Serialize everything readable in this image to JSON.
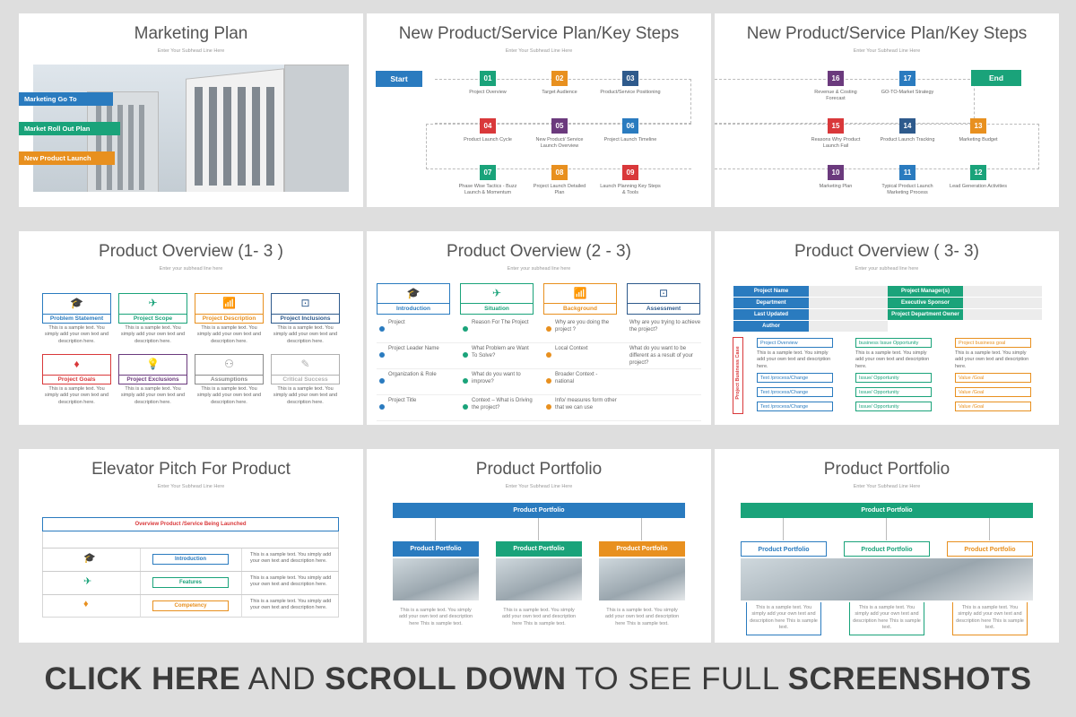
{
  "slides": {
    "marketing": {
      "title": "Marketing Plan",
      "subtitle": "Enter Your Subhead Line Here",
      "tags": [
        "Marketing Go To",
        "Market Roll Out Plan",
        "New Product Launch"
      ]
    },
    "steps1": {
      "title": "New Product/Service Plan/Key Steps",
      "subtitle": "Enter Your Subhead Line Here",
      "start": "Start",
      "steps": [
        {
          "num": "01",
          "label": "Project Overview",
          "color": "#1aa37a"
        },
        {
          "num": "02",
          "label": "Target Audience",
          "color": "#e8901f"
        },
        {
          "num": "03",
          "label": "Product/Service Positioning",
          "color": "#2e5a8c"
        },
        {
          "num": "04",
          "label": "Product Launch Cycle",
          "color": "#d9383a"
        },
        {
          "num": "05",
          "label": "New Product/ Service Launch Overview",
          "color": "#6b3a7d"
        },
        {
          "num": "06",
          "label": "Project Launch Timeline",
          "color": "#2a7bbf"
        },
        {
          "num": "07",
          "label": "Phase Wise Tactics - Buzz Launch & Momentum",
          "color": "#1aa37a"
        },
        {
          "num": "08",
          "label": "Project Launch Detailed Plan",
          "color": "#e8901f"
        },
        {
          "num": "09",
          "label": "Launch Planning Key Steps & Tools",
          "color": "#d9383a"
        }
      ]
    },
    "steps2": {
      "title": "New Product/Service Plan/Key Steps",
      "subtitle": "Enter Your Subhead Line Here",
      "end": "End",
      "steps": [
        {
          "num": "16",
          "label": "Revenue & Costing Forecast",
          "color": "#6b3a7d"
        },
        {
          "num": "17",
          "label": "GO-TO-Market Strategy",
          "color": "#2a7bbf"
        },
        {
          "num": "15",
          "label": "Reasons Why Product Launch Fail",
          "color": "#d9383a"
        },
        {
          "num": "14",
          "label": "Product Launch Tracking",
          "color": "#2e5a8c"
        },
        {
          "num": "13",
          "label": "Marketing Budget",
          "color": "#e8901f"
        },
        {
          "num": "10",
          "label": "Marketing Plan",
          "color": "#6b3a7d"
        },
        {
          "num": "11",
          "label": "Typical Product Launch Marketing Process",
          "color": "#2a7bbf"
        },
        {
          "num": "12",
          "label": "Lead Generation Activities",
          "color": "#1aa37a"
        }
      ]
    },
    "ov1": {
      "title": "Product Overview (1- 3 )",
      "subtitle": "Enter your subhead line here",
      "sample": "This is a sample text. You simply add your own text and description here.",
      "cards": [
        {
          "label": "Problem Statement",
          "color": "#2a7bbf"
        },
        {
          "label": "Project Scope",
          "color": "#1aa37a"
        },
        {
          "label": "Project Description",
          "color": "#e8901f"
        },
        {
          "label": "Project Inclusions",
          "color": "#2e5a8c"
        },
        {
          "label": "Project Goals",
          "color": "#d9383a"
        },
        {
          "label": "Project Exclusions",
          "color": "#6b3a7d"
        },
        {
          "label": "Assumptions",
          "color": "#8a8a8a"
        },
        {
          "label": "Critical Success",
          "color": "#b0b0b0"
        }
      ]
    },
    "ov2": {
      "title": "Product Overview (2 - 3)",
      "subtitle": "Enter your subhead line here",
      "heads": [
        {
          "label": "Introduction",
          "color": "#2a7bbf"
        },
        {
          "label": "Situation",
          "color": "#1aa37a"
        },
        {
          "label": "Background",
          "color": "#e8901f"
        },
        {
          "label": "Assessment",
          "color": "#2e5a8c"
        }
      ],
      "rows": [
        [
          "Project",
          "Reason For The Project",
          "Why are you doing the project ?",
          "Why are you trying to achieve the project?"
        ],
        [
          "Project Leader Name",
          "What Problem are Want To Solve?",
          "Local Context",
          "What do you want to be different as a result of your project?"
        ],
        [
          "Organization & Role",
          "What do you want to improve?",
          "Broader Context - national",
          ""
        ],
        [
          "Project Title",
          "Context – What is Driving the project?",
          "Info/ measures form other that we can use",
          ""
        ]
      ]
    },
    "ov3": {
      "title": "Product Overview ( 3- 3)",
      "subtitle": "Enter your subhead line here",
      "left": [
        "Project Name",
        "Department",
        "Last Updated",
        "Author"
      ],
      "right": [
        "Project Manager(s)",
        "Executive Sponsor",
        "Project Department Owner"
      ],
      "vertical": "Project Business Case",
      "cols": [
        "Project Overview",
        "business Issue Opportunity",
        "Project business goal"
      ],
      "sample": "This is a sample text. You simply add your own text and description here.",
      "rowtags": [
        "Text /process/Change",
        "Issue/ Opportunity",
        "Value /Goal"
      ]
    },
    "elevator": {
      "title": "Elevator Pitch For Product",
      "subtitle": "Enter Your Subhead Line Here",
      "header": "Overview Product /Service Being Launched",
      "items": [
        {
          "label": "Introduction",
          "color": "#2a7bbf",
          "icon": "graduation-cap-icon"
        },
        {
          "label": "Features",
          "color": "#1aa37a",
          "icon": "paper-plane-icon"
        },
        {
          "label": "Competency",
          "color": "#e8901f",
          "icon": "diamond-icon"
        }
      ],
      "sample": "This is a sample text. You simply add your own text and description here."
    },
    "portfolio1": {
      "title": "Product Portfolio",
      "subtitle": "Enter Your Subhead Line Here",
      "top": "Product Portfolio",
      "cols": [
        {
          "label": "Product Portfolio",
          "color": "#2a7bbf"
        },
        {
          "label": "Product Portfolio",
          "color": "#1aa37a"
        },
        {
          "label": "Product Portfolio",
          "color": "#e8901f"
        }
      ],
      "sample": "This is a sample text. You simply add your own text and description here This is sample text."
    },
    "portfolio2": {
      "title": "Product Portfolio",
      "subtitle": "Enter Your Subhead Line Here",
      "top": "Product Portfolio",
      "cols": [
        {
          "label": "Product Portfolio",
          "color": "#2a7bbf"
        },
        {
          "label": "Product Portfolio",
          "color": "#1aa37a"
        },
        {
          "label": "Product Portfolio",
          "color": "#e8901f"
        }
      ],
      "sample": "This is a sample text. You simply add your own text and description here This is sample text."
    }
  },
  "cta": {
    "part1": "CLICK HERE",
    "part2": " AND ",
    "part3": "SCROLL DOWN",
    "part4": " TO SEE FULL ",
    "part5": "SCREENSHOTS"
  }
}
